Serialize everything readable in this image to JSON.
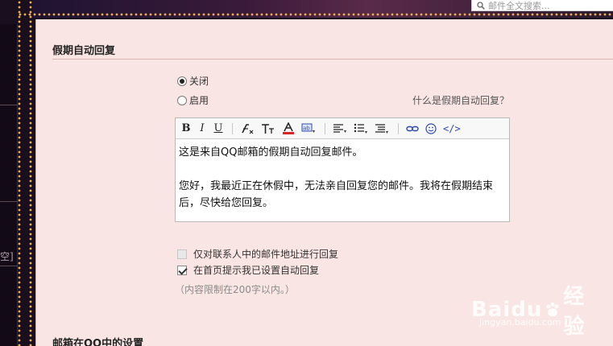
{
  "search": {
    "placeholder": "邮件全文搜索..."
  },
  "left_panel": {
    "clipped_text": "空]"
  },
  "vacation": {
    "section_title": "假期自动回复",
    "option_off": "关闭",
    "option_on": "启用",
    "selected": "关闭",
    "help_link": "什么是假期自动回复？",
    "editor_line1": "这是来自QQ邮箱的假期自动回复邮件。",
    "editor_line2": "您好，我最近正在休假中，无法亲自回复您的邮件。我将在假期结束后，尽快给您回复。",
    "contacts_only_label": "仅对联系人中的邮件地址进行回复",
    "contacts_only_checked": false,
    "homepage_notice_label": "在首页提示我已设置自动回复",
    "homepage_notice_checked": true,
    "limit_note": "（内容限制在200字以内。）"
  },
  "toolbar": {
    "bold": "B",
    "italic": "I",
    "underline": "U",
    "html": "</>"
  },
  "qq_settings": {
    "section_title": "邮箱在QQ中的设置"
  },
  "watermark": {
    "brand": "Baidu",
    "label": "经验",
    "url": "jingyan.baidu.com"
  }
}
